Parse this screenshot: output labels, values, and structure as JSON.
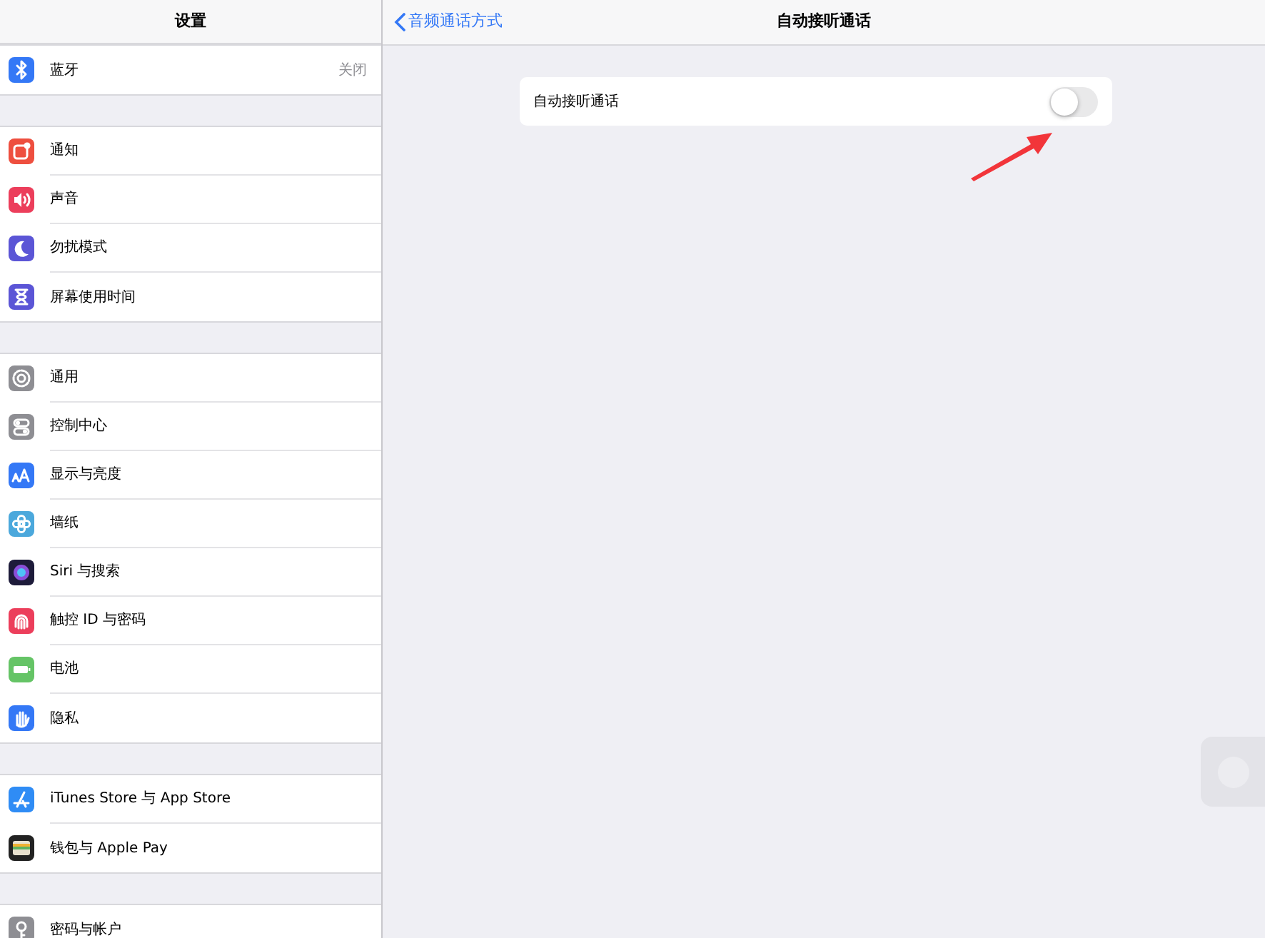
{
  "sidebar": {
    "title": "设置",
    "groups": [
      [
        {
          "kind": "bluetooth",
          "label": "蓝牙",
          "value": "关闭"
        }
      ],
      [
        {
          "kind": "notifications",
          "label": "通知"
        },
        {
          "kind": "sounds",
          "label": "声音"
        },
        {
          "kind": "dnd",
          "label": "勿扰模式"
        },
        {
          "kind": "screentime",
          "label": "屏幕使用时间"
        }
      ],
      [
        {
          "kind": "general",
          "label": "通用"
        },
        {
          "kind": "control",
          "label": "控制中心"
        },
        {
          "kind": "display",
          "label": "显示与亮度"
        },
        {
          "kind": "wallpaper",
          "label": "墙纸"
        },
        {
          "kind": "siri",
          "label": "Siri 与搜索"
        },
        {
          "kind": "touchid",
          "label": "触控 ID 与密码"
        },
        {
          "kind": "battery",
          "label": "电池"
        },
        {
          "kind": "privacy",
          "label": "隐私"
        }
      ],
      [
        {
          "kind": "appstore",
          "label": "iTunes Store 与 App Store"
        },
        {
          "kind": "wallet",
          "label": "钱包与 Apple Pay"
        }
      ],
      [
        {
          "kind": "passwords",
          "label": "密码与帐户"
        }
      ]
    ]
  },
  "detail": {
    "back_label": "音频通话方式",
    "title": "自动接听通话",
    "rows": [
      {
        "label": "自动接听通话",
        "on": false
      }
    ]
  }
}
